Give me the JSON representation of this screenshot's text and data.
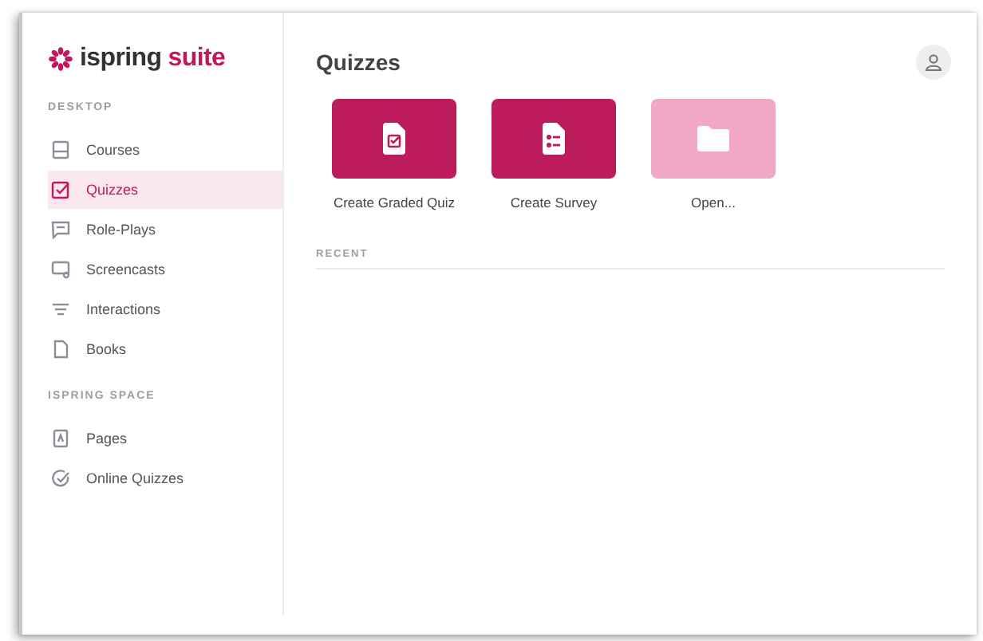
{
  "logo": {
    "brand": "ispring",
    "product": "suite"
  },
  "sidebar": {
    "sections": [
      {
        "heading": "DESKTOP",
        "items": [
          {
            "kind": "courses",
            "label": "Courses",
            "selected": false
          },
          {
            "kind": "quizzes",
            "label": "Quizzes",
            "selected": true
          },
          {
            "kind": "roleplays",
            "label": "Role-Plays",
            "selected": false
          },
          {
            "kind": "screencasts",
            "label": "Screencasts",
            "selected": false
          },
          {
            "kind": "interactions",
            "label": "Interactions",
            "selected": false
          },
          {
            "kind": "books",
            "label": "Books",
            "selected": false
          }
        ]
      },
      {
        "heading": "ISPRING SPACE",
        "items": [
          {
            "kind": "pages",
            "label": "Pages",
            "selected": false
          },
          {
            "kind": "online",
            "label": "Online Quizzes",
            "selected": false
          }
        ]
      }
    ]
  },
  "main": {
    "title": "Quizzes",
    "actions": [
      {
        "kind": "graded",
        "label": "Create Graded Quiz",
        "disabled": false
      },
      {
        "kind": "survey",
        "label": "Create Survey",
        "disabled": false
      },
      {
        "kind": "open",
        "label": "Open...",
        "disabled": true
      }
    ],
    "recent_heading": "RECENT"
  }
}
